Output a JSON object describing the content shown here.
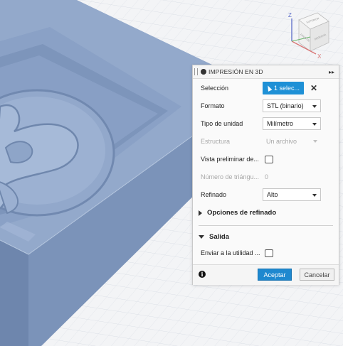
{
  "panel": {
    "title": "IMPRESIÓN EN 3D",
    "expand_glyph": "▸▸",
    "rows": {
      "seleccion": {
        "label": "Selección",
        "value": "1 selec...",
        "clear": "✕"
      },
      "formato": {
        "label": "Formato",
        "value": "STL (binario)"
      },
      "tipo_unidad": {
        "label": "Tipo de unidad",
        "value": "Milímetro"
      },
      "estructura": {
        "label": "Estructura",
        "value": "Un archivo"
      },
      "vista_previa": {
        "label": "Vista preliminar de..."
      },
      "numero_triangulos": {
        "label": "Número de triángu...",
        "value": "0"
      },
      "refinado": {
        "label": "Refinado",
        "value": "Alto"
      }
    },
    "sections": {
      "opciones_refinado": "Opciones de refinado",
      "salida": "Salida"
    },
    "enviar": {
      "label": "Enviar a la utilidad ..."
    },
    "buttons": {
      "accept": "Aceptar",
      "cancel": "Cancelar",
      "info": "i"
    }
  },
  "viewcube": {
    "axis_z": "Z",
    "axis_x": "X",
    "faces": [
      "SUPERIOR",
      "FRONTAL",
      "DERECHA"
    ]
  },
  "colors": {
    "model_fill": "#8ea5c8",
    "model_dark": "#6f87ad",
    "selection_blue": "#1e90d6",
    "accept_blue": "#1e88cf"
  }
}
